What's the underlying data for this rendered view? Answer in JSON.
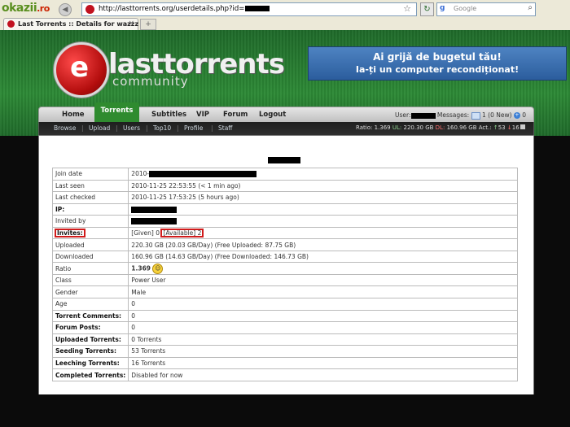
{
  "browser": {
    "okazii_logo": "okazii",
    "okazii_logo_tld": ".ro",
    "url": "http://lasttorrents.org/userdetails.php?id=",
    "search_placeholder": "Google",
    "search_engine_icon": "google-icon",
    "tab_title": "Last Torrents :: Details for wazzz",
    "new_tab": "+"
  },
  "site": {
    "brand": "lasttorrents",
    "brand_sub": "community",
    "ad_line1": "Ai grijă de bugetul tău!",
    "ad_line2": "Ia-ți un computer recondiționat!",
    "accent_color": "#2f8b2f"
  },
  "nav": {
    "items": [
      "Home",
      "Torrents",
      "Subtitles",
      "VIP",
      "Forum",
      "Logout"
    ],
    "user_label": "User:",
    "messages_label": "Messages:",
    "messages_count": "1 (0 New)",
    "new_count": "0"
  },
  "subnav": {
    "items": [
      "Browse",
      "Upload",
      "Users",
      "Top10",
      "Profile",
      "Staff"
    ],
    "ratio_label": "Ratio:",
    "ratio": "1.369",
    "ul_label": "UL:",
    "ul": "220.30 GB",
    "dl_label": "DL:",
    "dl": "160.96 GB",
    "act_label": "Act.:",
    "act_up": "53",
    "act_down": "16"
  },
  "details": {
    "join_date_key": "Join date",
    "join_date_val": "2010-",
    "last_seen_key": "Last seen",
    "last_seen_val": "2010-11-25 22:53:55 (< 1 min ago)",
    "last_checked_key": "Last checked",
    "last_checked_val": "2010-11-25 17:53:25 (5 hours ago)",
    "ip_key": "IP:",
    "invited_by_key": "Invited by",
    "invites_key": "Invites:",
    "invites_given_label": "[Given]",
    "invites_given": "0",
    "invites_available_label": "[Available]",
    "invites_available": "2",
    "uploaded_key": "Uploaded",
    "uploaded_val": "220.30 GB (20.03 GB/Day) (Free Uploaded: 87.75 GB)",
    "downloaded_key": "Downloaded",
    "downloaded_val": "160.96 GB (14.63 GB/Day) (Free Downloaded: 146.73 GB)",
    "ratio_key": "Ratio",
    "ratio_val": "1.369",
    "class_key": "Class",
    "class_val": "Power User",
    "gender_key": "Gender",
    "gender_val": "Male",
    "age_key": "Age",
    "age_val": "0",
    "torrent_comments_key": "Torrent Comments:",
    "torrent_comments_val": "0",
    "forum_posts_key": "Forum Posts:",
    "forum_posts_val": "0",
    "uploaded_torrents_key": "Uploaded Torrents:",
    "uploaded_torrents_val": "0 Torrents",
    "seeding_torrents_key": "Seeding Torrents:",
    "seeding_torrents_val": "53 Torrents",
    "leeching_torrents_key": "Leeching Torrents:",
    "leeching_torrents_val": "16 Torrents",
    "completed_torrents_key": "Completed Torrents:",
    "completed_torrents_val": "Disabled for now"
  }
}
